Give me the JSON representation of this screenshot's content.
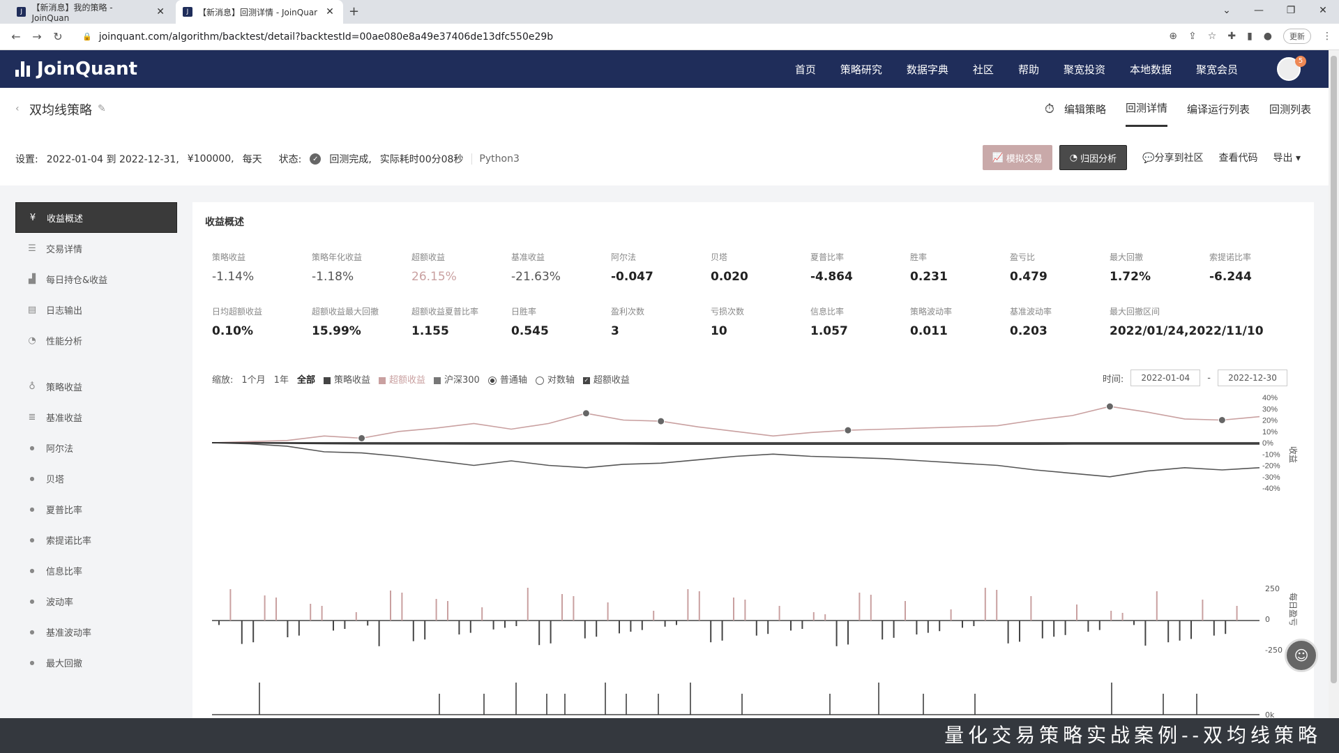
{
  "browser": {
    "tabs": [
      {
        "title": "【新消息】我的策略 - JoinQuan"
      },
      {
        "title": "【新消息】回测详情 - JoinQuar"
      }
    ],
    "url": "joinquant.com/algorithm/backtest/detail?backtestId=00ae080e8a49e37406de13dfc550e29b",
    "update_label": "更新"
  },
  "nav": {
    "brand": "JoinQuant",
    "items": [
      "首页",
      "策略研究",
      "数据字典",
      "社区",
      "帮助",
      "聚宽投资",
      "本地数据",
      "聚宽会员"
    ],
    "badge": "5"
  },
  "header": {
    "strategy_name": "双均线策略",
    "tabs": [
      "编辑策略",
      "回测详情",
      "编译运行列表",
      "回测列表"
    ],
    "active_tab": "回测详情"
  },
  "settings": {
    "label": "设置:",
    "range": "2022-01-04 到 2022-12-31,",
    "capital": "¥100000,",
    "freq": "每天",
    "status_label": "状态:",
    "status": "回测完成,",
    "elapsed": "实际耗时00分08秒",
    "lang": "Python3"
  },
  "actions": {
    "sim": "模拟交易",
    "attribution": "归因分析",
    "share": "分享到社区",
    "code": "查看代码",
    "export": "导出"
  },
  "sidebar": [
    {
      "label": "收益概述",
      "icon": "money-icon",
      "active": true
    },
    {
      "label": "交易详情",
      "icon": "list-icon"
    },
    {
      "label": "每日持仓&收益",
      "icon": "bar-chart-icon"
    },
    {
      "label": "日志输出",
      "icon": "log-icon"
    },
    {
      "label": "性能分析",
      "icon": "pie-icon"
    },
    {
      "label": "策略收益",
      "icon": "bulb-icon"
    },
    {
      "label": "基准收益",
      "icon": "stack-icon"
    },
    {
      "label": "阿尔法",
      "sub": true
    },
    {
      "label": "贝塔",
      "sub": true
    },
    {
      "label": "夏普比率",
      "sub": true
    },
    {
      "label": "索提诺比率",
      "sub": true
    },
    {
      "label": "信息比率",
      "sub": true
    },
    {
      "label": "波动率",
      "sub": true
    },
    {
      "label": "基准波动率",
      "sub": true
    },
    {
      "label": "最大回撤",
      "sub": true
    }
  ],
  "panel_title": "收益概述",
  "metrics_row1": [
    {
      "k": "策略收益",
      "v": "-1.14%",
      "style": "thin"
    },
    {
      "k": "策略年化收益",
      "v": "-1.18%",
      "style": "thin"
    },
    {
      "k": "超额收益",
      "v": "26.15%",
      "style": "pos"
    },
    {
      "k": "基准收益",
      "v": "-21.63%",
      "style": "thin"
    },
    {
      "k": "阿尔法",
      "v": "-0.047"
    },
    {
      "k": "贝塔",
      "v": "0.020"
    },
    {
      "k": "夏普比率",
      "v": "-4.864"
    },
    {
      "k": "胜率",
      "v": "0.231"
    },
    {
      "k": "盈亏比",
      "v": "0.479"
    },
    {
      "k": "最大回撤",
      "v": "1.72%"
    },
    {
      "k": "索提诺比率",
      "v": "-6.244"
    }
  ],
  "metrics_row2": [
    {
      "k": "日均超额收益",
      "v": "0.10%"
    },
    {
      "k": "超额收益最大回撤",
      "v": "15.99%"
    },
    {
      "k": "超额收益夏普比率",
      "v": "1.155"
    },
    {
      "k": "日胜率",
      "v": "0.545"
    },
    {
      "k": "盈利次数",
      "v": "3"
    },
    {
      "k": "亏损次数",
      "v": "10"
    },
    {
      "k": "信息比率",
      "v": "1.057"
    },
    {
      "k": "策略波动率",
      "v": "0.011"
    },
    {
      "k": "基准波动率",
      "v": "0.203"
    },
    {
      "k": "最大回撤区间",
      "v": "2022/01/24,2022/11/10"
    }
  ],
  "controls": {
    "zoom_label": "缩放:",
    "zoom": [
      "1个月",
      "1年",
      "全部"
    ],
    "series": [
      "策略收益",
      "超额收益",
      "沪深300"
    ],
    "axis": [
      "普通轴",
      "对数轴"
    ],
    "excess_check": "超额收益",
    "time_label": "时间:",
    "start": "2022-01-04",
    "dash": "-",
    "end": "2022-12-30"
  },
  "chart_data": {
    "type": "line",
    "x_range": [
      "2022-01-04",
      "2022-12-30"
    ],
    "ylabel": "收益",
    "yticks": [
      "40%",
      "30%",
      "20%",
      "10%",
      "0%",
      "-10%",
      "-20%",
      "-30%",
      "-40%"
    ],
    "ylim": [
      -40,
      40
    ],
    "series": [
      {
        "name": "超额收益",
        "values": [
          0,
          1,
          2,
          6,
          4,
          10,
          13,
          17,
          12,
          17,
          26,
          20,
          19,
          14,
          10,
          6,
          9,
          11,
          12,
          13,
          14,
          15,
          20,
          24,
          32,
          27,
          21,
          20,
          23
        ]
      },
      {
        "name": "沪深300",
        "values": [
          0,
          -1,
          -3,
          -8,
          -9,
          -12,
          -16,
          -20,
          -16,
          -20,
          -22,
          -19,
          -18,
          -15,
          -12,
          -10,
          -12,
          -13,
          -14,
          -16,
          -18,
          -20,
          -24,
          -27,
          -30,
          -25,
          -22,
          -24,
          -22
        ]
      },
      {
        "name": "策略收益",
        "values": [
          0,
          -0.2,
          -0.5,
          -0.8,
          -0.9,
          -1,
          -1,
          -1.1,
          -1.1,
          -1.1,
          -1.1,
          -1.1,
          -1.2,
          -1.2,
          -1.2,
          -1.2,
          -1.2,
          -1.2,
          -1.2,
          -1.2,
          -1.2,
          -1.2,
          -1.2,
          -1.1,
          -1.1,
          -1.1,
          -1.1,
          -1.1,
          -1.1
        ]
      }
    ],
    "daily_label": "每日盈亏",
    "daily_ticks": [
      "250",
      "0",
      "-250"
    ],
    "volume_tick": "0k"
  },
  "caption": "量化交易策略实战案例--双均线策略"
}
